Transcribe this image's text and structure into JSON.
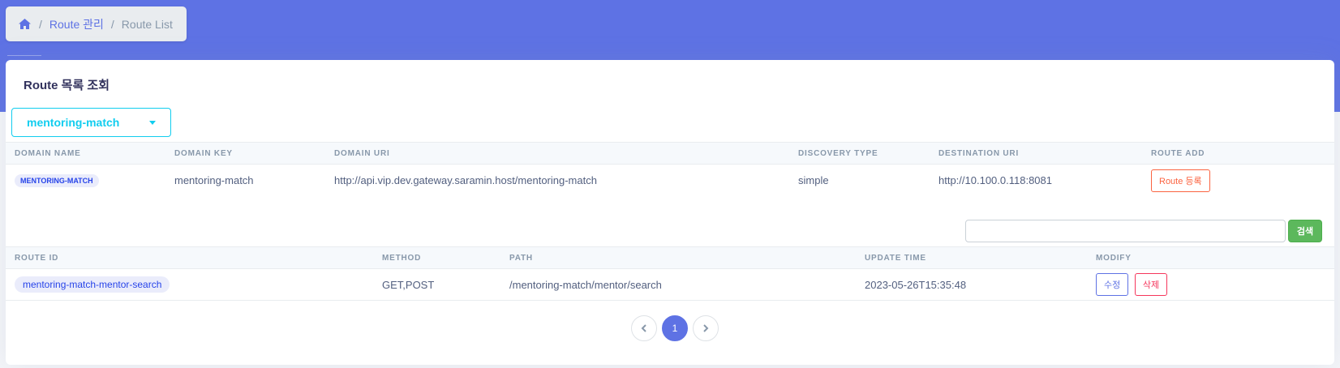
{
  "breadcrumb": {
    "icon": "home-icon",
    "items": [
      "Route 관리",
      "Route List"
    ],
    "separator": "/"
  },
  "card": {
    "title": "Route 목록 조회"
  },
  "domain_select": {
    "value": "mentoring-match",
    "icon": "caret-down-icon"
  },
  "domain_table": {
    "headers": [
      "Domain Name",
      "Domain Key",
      "Domain URI",
      "Discovery Type",
      "Destination URI",
      "Route Add"
    ],
    "row": {
      "name": "MENTORING-MATCH",
      "key": "mentoring-match",
      "uri": "http://api.vip.dev.gateway.saramin.host/mentoring-match",
      "discovery": "simple",
      "destination": "http://10.100.0.118:8081",
      "add_label": "Route 등록"
    }
  },
  "search": {
    "value": "",
    "button_label": "검색"
  },
  "route_table": {
    "headers": [
      "Route ID",
      "Method",
      "Path",
      "Update Time",
      "Modify"
    ],
    "rows": [
      {
        "id": "mentoring-match-mentor-search",
        "method": "GET,POST",
        "path": "/mentoring-match/mentor/search",
        "update_time": "2023-05-26T15:35:48",
        "edit_label": "수정",
        "delete_label": "삭제"
      }
    ]
  },
  "pagination": {
    "prev_icon": "chevron-left-icon",
    "current": "1",
    "next_icon": "chevron-right-icon"
  },
  "colors": {
    "primary": "#5e72e4",
    "info": "#11cdef",
    "danger": "#f5365c",
    "warning": "#fb6340",
    "success": "#5cb85c"
  }
}
